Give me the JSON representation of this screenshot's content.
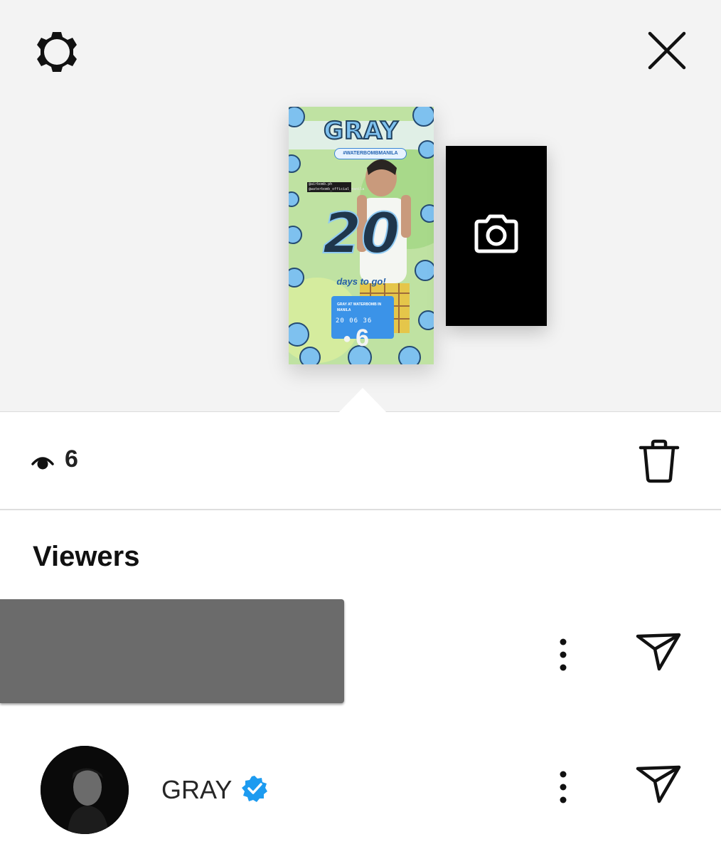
{
  "header": {
    "settings_icon": "gear-icon",
    "close_icon": "close-icon"
  },
  "story": {
    "title": "GRAY",
    "hashtag": "#WATERBOMBMANILA",
    "credit": "@airbomb.ph\n@waterbomb_official_manila",
    "big_number": "20",
    "tagline": "days to go!",
    "countdown_title": "GRAY AT WATERBOMB IN MANILA",
    "countdown_time": "20 06 36",
    "views_overlay": "6"
  },
  "camera_tile": {
    "icon": "camera-icon"
  },
  "stats": {
    "views_icon": "eye-icon",
    "views_count": "6",
    "delete_icon": "trash-icon"
  },
  "viewers": {
    "heading": "Viewers",
    "list": [
      {
        "username": "",
        "redacted": true
      },
      {
        "username": "GRAY",
        "verified": true,
        "verified_color": "#1d9bf0"
      }
    ]
  },
  "colors": {
    "top_background": "#f3f3f3",
    "verified_blue": "#1d9bf0"
  }
}
